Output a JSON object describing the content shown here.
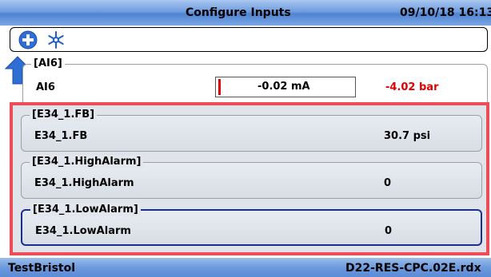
{
  "header": {
    "title": "Configure Inputs",
    "datetime": "09/10/18 16:13"
  },
  "toolbar": {
    "add_icon": "plus-circle-icon",
    "update_icon": "asterisk-snowflake-icon"
  },
  "nav": {
    "up_icon": "up-arrow-icon"
  },
  "inputs": [
    {
      "legend": "[AI6]",
      "name": "AI6",
      "raw_value": "-0.02 mA",
      "value": "-4.02 bar",
      "value_color": "#e00000"
    },
    {
      "legend": "[E34_1.FB]",
      "name": "E34_1.FB",
      "value": "30.7 psi"
    },
    {
      "legend": "[E34_1.HighAlarm]",
      "name": "E34_1.HighAlarm",
      "value": "0"
    },
    {
      "legend": "[E34_1.LowAlarm]",
      "name": "E34_1.LowAlarm",
      "value": "0"
    }
  ],
  "colors": {
    "selection_border": "#ee4c57",
    "focus_border": "#1c2f8f",
    "alarm_text": "#e00000"
  },
  "status": {
    "left": "TestBristol",
    "right": "D22-RES-CPC.02E.rdx"
  }
}
